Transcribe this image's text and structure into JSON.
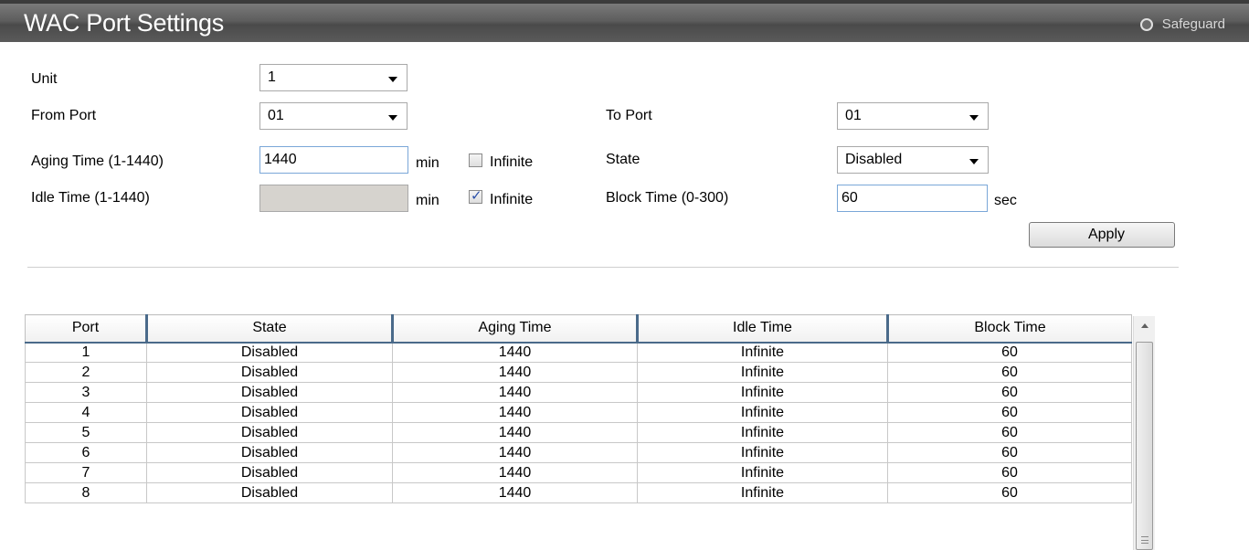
{
  "header": {
    "title": "WAC Port Settings",
    "safeguard_label": "Safeguard"
  },
  "form": {
    "unit_label": "Unit",
    "unit_value": "1",
    "from_port_label": "From Port",
    "from_port_value": "01",
    "to_port_label": "To Port",
    "to_port_value": "01",
    "aging_label": "Aging Time (1-1440)",
    "aging_value": "1440",
    "aging_unit": "min",
    "aging_infinite_label": "Infinite",
    "aging_infinite_checked": false,
    "state_label": "State",
    "state_value": "Disabled",
    "idle_label": "Idle Time (1-1440)",
    "idle_value": "",
    "idle_unit": "min",
    "idle_infinite_label": "Infinite",
    "idle_infinite_checked": true,
    "block_label": "Block Time (0-300)",
    "block_value": "60",
    "block_unit": "sec",
    "apply_label": "Apply"
  },
  "table": {
    "headers": [
      "Port",
      "State",
      "Aging Time",
      "Idle Time",
      "Block Time"
    ],
    "rows": [
      [
        "1",
        "Disabled",
        "1440",
        "Infinite",
        "60"
      ],
      [
        "2",
        "Disabled",
        "1440",
        "Infinite",
        "60"
      ],
      [
        "3",
        "Disabled",
        "1440",
        "Infinite",
        "60"
      ],
      [
        "4",
        "Disabled",
        "1440",
        "Infinite",
        "60"
      ],
      [
        "5",
        "Disabled",
        "1440",
        "Infinite",
        "60"
      ],
      [
        "6",
        "Disabled",
        "1440",
        "Infinite",
        "60"
      ],
      [
        "7",
        "Disabled",
        "1440",
        "Infinite",
        "60"
      ],
      [
        "8",
        "Disabled",
        "1440",
        "Infinite",
        "60"
      ]
    ]
  },
  "icons": {
    "safeguard": "safeguard-ring-icon",
    "dropdown": "chevron-down-icon",
    "scroll_up": "scroll-up-arrow-icon"
  },
  "colors": {
    "titlebar": "#5d5d5d",
    "header_border": "#4a6a8a"
  }
}
